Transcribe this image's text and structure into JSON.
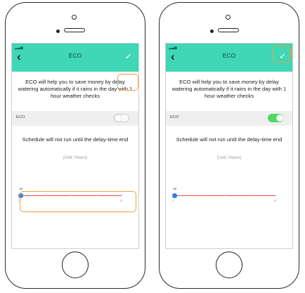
{
  "screens": [
    {
      "nav_title": "ECO",
      "back_icon": "chevron-left-icon",
      "check_icon": "check-icon",
      "description": "ECO will help you to save money by delay watering automatically if it rains in the day with 1 hour weather checks",
      "eco_label": "ECO",
      "eco_enabled": false,
      "schedule_note": "Schedule will not run until the delay-time end",
      "unit_label": "(Unit: Hours)",
      "slider": {
        "value": "12",
        "min": "0",
        "max": "48"
      }
    },
    {
      "nav_title": "ECO",
      "back_icon": "chevron-left-icon",
      "check_icon": "check-icon",
      "description": "ECO will help you to save money by delay watering automatically if it rains in the day with 1 hour weather checks",
      "eco_label": "ECO",
      "eco_enabled": true,
      "schedule_note": "Schedule will not run until the delay-time end",
      "unit_label": "(Unit: Hours)",
      "slider": {
        "value": "12",
        "min": "0",
        "max": "48"
      }
    }
  ],
  "highlight_color": "#f2a03d",
  "accent_color": "#3fd7b5"
}
